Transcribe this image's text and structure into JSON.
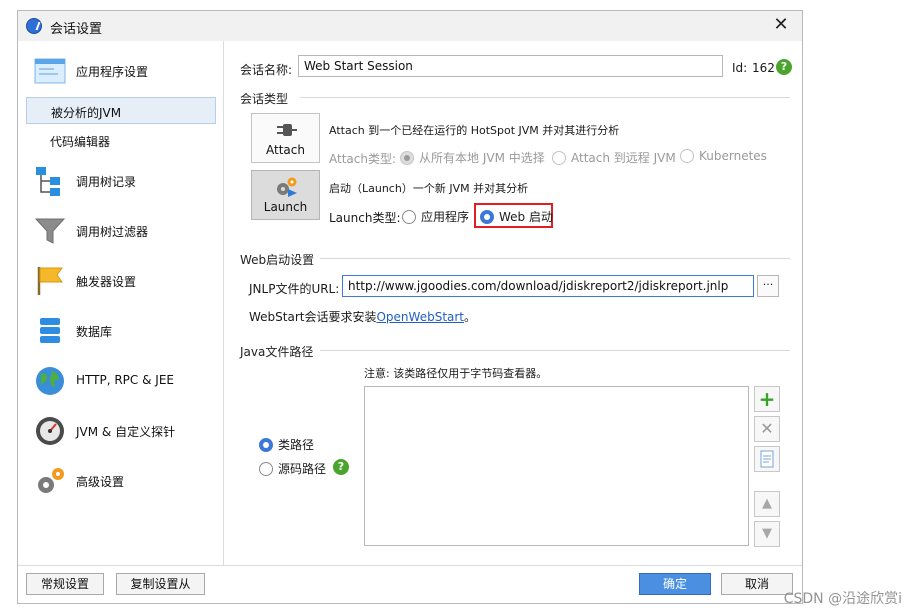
{
  "window": {
    "title": "会话设置",
    "close_symbol": "✕"
  },
  "sidebar": {
    "items": [
      {
        "label": "应用程序设置",
        "icon": "app-settings-icon"
      },
      {
        "label": "被分析的JVM",
        "selected": true
      },
      {
        "label": "代码编辑器"
      },
      {
        "label": "调用树记录",
        "icon": "call-tree-icon"
      },
      {
        "label": "调用树过滤器",
        "icon": "filter-icon"
      },
      {
        "label": "触发器设置",
        "icon": "flag-icon"
      },
      {
        "label": "数据库",
        "icon": "database-icon"
      },
      {
        "label": "HTTP, RPC & JEE",
        "icon": "globe-icon"
      },
      {
        "label": "JVM & 自定义探针",
        "icon": "gauge-icon"
      },
      {
        "label": "高级设置",
        "icon": "gears-icon"
      }
    ]
  },
  "session": {
    "name_label": "会话名称:",
    "name_value": "Web Start Session",
    "id_label": "Id:",
    "id_value": "162"
  },
  "session_type": {
    "section_title": "会话类型",
    "attach": {
      "button_label": "Attach",
      "description": "Attach 到一个已经在运行的 HotSpot JVM 并对其进行分析",
      "type_label": "Attach类型:",
      "options": [
        "从所有本地 JVM 中选择",
        "Attach 到远程 JVM",
        "Kubernetes"
      ]
    },
    "launch": {
      "button_label": "Launch",
      "description": "启动（Launch）一个新 JVM 并对其分析",
      "type_label": "Launch类型:",
      "options": [
        "应用程序",
        "Web 启动"
      ]
    }
  },
  "web_start": {
    "section_title": "Web启动设置",
    "jnlp_label": "JNLP文件的URL:",
    "jnlp_value": "http://www.jgoodies.com/download/jdiskreport2/jdiskreport.jnlp",
    "browse_label": "···",
    "note_prefix": "WebStart会话要求安装",
    "note_link": "OpenWebStart",
    "note_suffix": "。"
  },
  "java_path": {
    "section_title": "Java文件路径",
    "note": "注意: 该类路径仅用于字节码查看器。",
    "options": [
      "类路径",
      "源码路径"
    ]
  },
  "footer": {
    "general_settings": "常规设置",
    "copy_settings": "复制设置从",
    "ok": "确定",
    "cancel": "取消"
  },
  "watermark": "CSDN @沿途欣赏i",
  "colors": {
    "accent": "#3b78d8",
    "highlight": "#e02020",
    "help": "#4aa52e"
  }
}
